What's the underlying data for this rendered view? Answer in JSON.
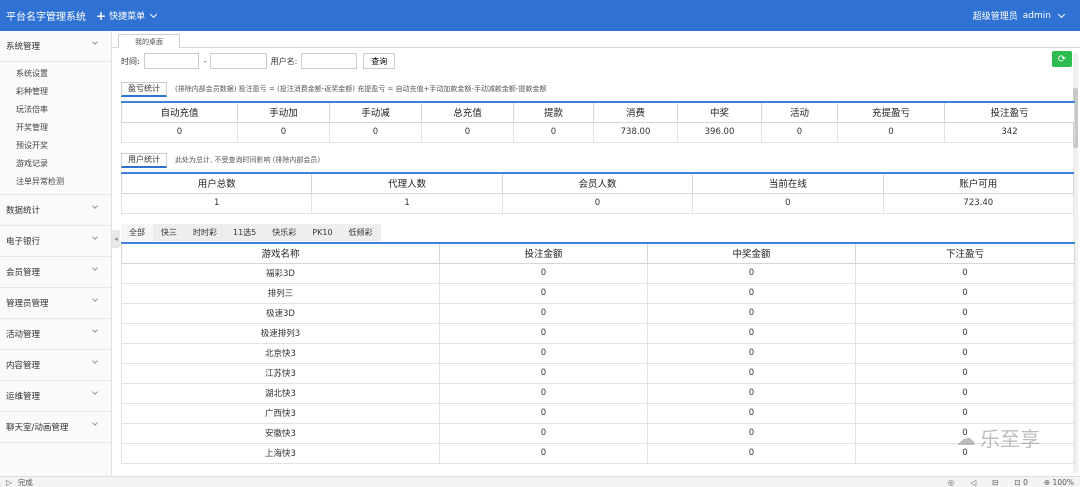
{
  "header": {
    "brand": "平台名字管理系统",
    "quick_menu": "快捷菜单",
    "role": "超级管理员",
    "user": "admin"
  },
  "sidebar": {
    "groups": [
      {
        "label": "系统管理",
        "items": [
          "系统设置",
          "彩种管理",
          "玩法倍率",
          "开奖管理",
          "预设开奖",
          "游戏记录",
          "注单异常检测"
        ]
      },
      {
        "label": "数据统计"
      },
      {
        "label": "电子银行"
      },
      {
        "label": "会员管理"
      },
      {
        "label": "管理员管理"
      },
      {
        "label": "活动管理"
      },
      {
        "label": "内容管理"
      },
      {
        "label": "运维管理"
      },
      {
        "label": "聊天室/动画管理"
      }
    ]
  },
  "tabs": {
    "home": "我的桌面"
  },
  "filter": {
    "time_label": "时间:",
    "dash": "-",
    "username_label": "用户名:",
    "query_button": "查询"
  },
  "profit": {
    "title": "盈亏统计",
    "note": "(排除内部会员数据)  投注盈亏 = (投注消费金额-返奖金额)     充提盈亏 = 自动充值+手动加款金额-手动减款金额-提款金额",
    "headers": [
      "自动充值",
      "手动加",
      "手动减",
      "总充值",
      "提款",
      "消费",
      "中奖",
      "活动",
      "充提盈亏",
      "投注盈亏"
    ],
    "values": [
      "0",
      "0",
      "0",
      "0",
      "0",
      "738.00",
      "396.00",
      "0",
      "0",
      "342"
    ]
  },
  "users": {
    "title": "用户统计",
    "note": "此处为总计, 不受查询时间影响 (排除内部会员)",
    "headers": [
      "用户总数",
      "代理人数",
      "会员人数",
      "当前在线",
      "账户可用"
    ],
    "values": [
      "1",
      "1",
      "0",
      "0",
      "723.40"
    ]
  },
  "game_tabs": [
    "全部",
    "快三",
    "时时彩",
    "11选5",
    "快乐彩",
    "PK10",
    "低频彩"
  ],
  "games": {
    "headers": [
      "游戏名称",
      "投注金额",
      "中奖金额",
      "下注盈亏"
    ],
    "rows": [
      [
        "福彩3D",
        "0",
        "0",
        "0"
      ],
      [
        "排列三",
        "0",
        "0",
        "0"
      ],
      [
        "极速3D",
        "0",
        "0",
        "0"
      ],
      [
        "极速排列3",
        "0",
        "0",
        "0"
      ],
      [
        "北京快3",
        "0",
        "0",
        "0"
      ],
      [
        "江苏快3",
        "0",
        "0",
        "0"
      ],
      [
        "湖北快3",
        "0",
        "0",
        "0"
      ],
      [
        "广西快3",
        "0",
        "0",
        "0"
      ],
      [
        "安徽快3",
        "0",
        "0",
        "0"
      ],
      [
        "上海快3",
        "0",
        "0",
        "0"
      ]
    ]
  },
  "statusbar": {
    "left": "完成",
    "zoom": "100%",
    "count": "0"
  },
  "watermark": "乐至享",
  "colors": {
    "topbar": "#2f72d3",
    "accent": "#3d82d8",
    "refresh": "#2bbb4e"
  }
}
